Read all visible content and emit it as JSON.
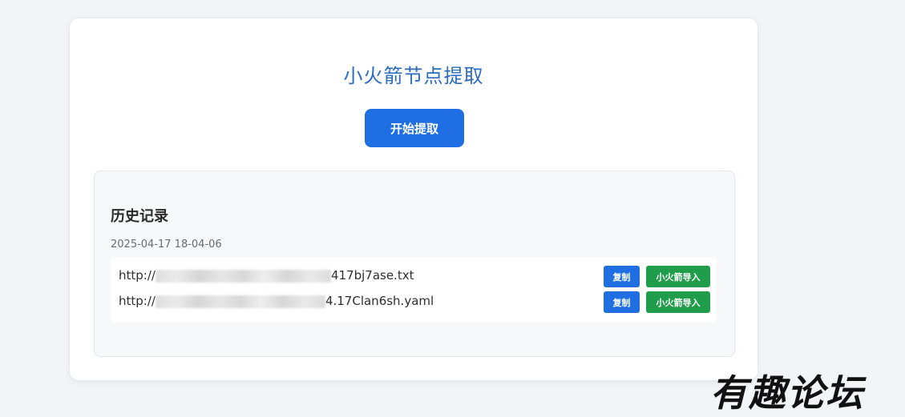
{
  "page": {
    "title": "小火箭节点提取",
    "start_button": "开始提取"
  },
  "history": {
    "title": "历史记录",
    "date": "2025-04-17 18-04-06",
    "entries": [
      {
        "url_prefix": "http://",
        "url_suffix": "417bj7ase.txt",
        "copy_label": "复制",
        "import_label": "小火箭导入"
      },
      {
        "url_prefix": "http://",
        "url_suffix": "4.17Clan6sh.yaml",
        "copy_label": "复制",
        "import_label": "小火箭导入"
      }
    ]
  },
  "watermark": {
    "text": "有趣论坛"
  },
  "colors": {
    "title": "#2a6bbf",
    "primary_button": "#1f6fe3",
    "import_button": "#1f9d4a",
    "background": "#f3f4f8"
  }
}
